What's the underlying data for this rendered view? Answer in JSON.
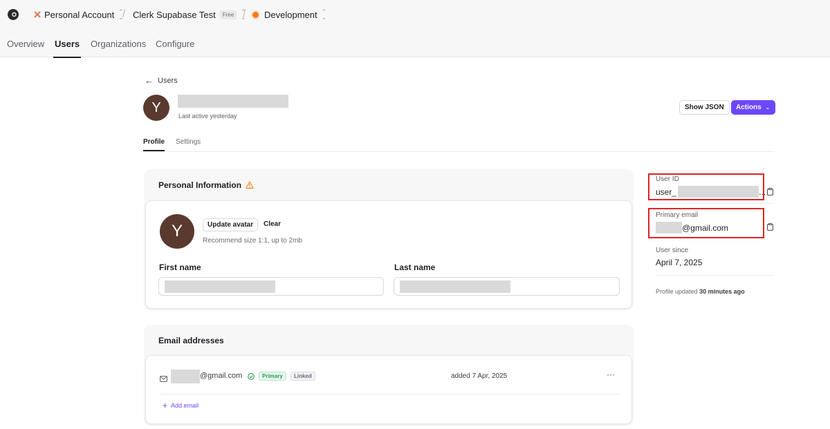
{
  "topbar": {
    "account": "Personal Account",
    "app": "Clerk Supabase Test",
    "app_badge": "Free",
    "environment": "Development"
  },
  "nav": {
    "tabs": [
      "Overview",
      "Users",
      "Organizations",
      "Configure"
    ],
    "active": "Users"
  },
  "back_link": "Users",
  "user": {
    "avatar_initial": "Y",
    "last_active": "Last active yesterday"
  },
  "header_actions": {
    "show_json": "Show JSON",
    "actions": "Actions"
  },
  "subtabs": [
    "Profile",
    "Settings"
  ],
  "personal_info": {
    "title": "Personal Information",
    "update_avatar": "Update avatar",
    "clear": "Clear",
    "hint": "Recommend size 1:1, up to 2mb",
    "first_name_label": "First name",
    "last_name_label": "Last name"
  },
  "email_section": {
    "title": "Email addresses",
    "email_domain": "@gmail.com",
    "tag_primary": "Primary",
    "tag_linked": "Linked",
    "added": "added 7 Apr, 2025",
    "more": "···",
    "add_email": "Add email"
  },
  "side_panel": {
    "user_id_label": "User ID",
    "user_id_prefix": "user_",
    "user_id_suffix": "...",
    "primary_email_label": "Primary email",
    "primary_email_domain": "@gmail.com",
    "user_since_label": "User since",
    "user_since_value": "April 7, 2025",
    "updated_prefix": "Profile updated",
    "updated_value": "30 minutes ago"
  },
  "colors": {
    "accent": "#6c47ff",
    "highlight": "#e02424",
    "avatar": "#5a3a2e"
  }
}
